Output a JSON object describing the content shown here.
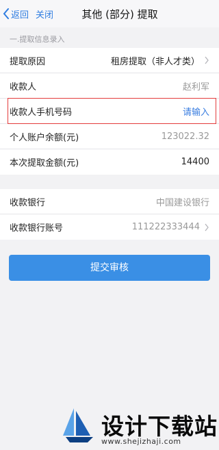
{
  "nav": {
    "back_label": "返回",
    "close_label": "关闭",
    "title": "其他 (部分) 提取"
  },
  "section_title": "一.提取信息录入",
  "form": {
    "reason_label": "提取原因",
    "reason_value": "租房提取（非人才类）",
    "payee_label": "收款人",
    "payee_value": "赵利军",
    "phone_label": "收款人手机号码",
    "phone_placeholder": "请输入",
    "balance_label": "个人账户余额(元)",
    "balance_value": "123022.32",
    "amount_label": "本次提取金额(元)",
    "amount_value": "14400"
  },
  "bank": {
    "bank_label": "收款银行",
    "bank_value": "中国建设银行",
    "account_label": "收款银行账号",
    "account_value": "111222333444"
  },
  "submit_label": "提交审核",
  "watermark": {
    "brand": "设计下载站",
    "url": "www.shejizhaji.com"
  },
  "colors": {
    "accent": "#3a8fe5",
    "link": "#2f7de1",
    "highlight_border": "#e33b3b"
  }
}
